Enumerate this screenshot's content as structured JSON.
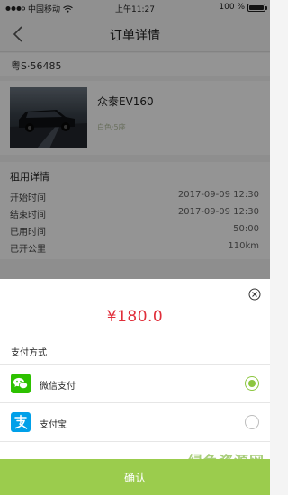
{
  "status_bar": {
    "carrier": "中国移动",
    "time": "上午11:27",
    "battery_text": "100 %",
    "battery_level": 1.0
  },
  "nav": {
    "title": "订单详情",
    "back_icon": "chevron-left-icon"
  },
  "order": {
    "plate": "粤S·56485",
    "car_name": "众泰EV160",
    "car_sub": "白色·5座"
  },
  "rental": {
    "title": "租用详情",
    "rows": [
      {
        "label": "开始时间",
        "value": "2017-09-09  12:30"
      },
      {
        "label": "结束时间",
        "value": "2017-09-09  12:30"
      },
      {
        "label": "已用时间",
        "value": "50:00"
      },
      {
        "label": "已开公里",
        "value": "110km"
      }
    ]
  },
  "payment": {
    "amount": "¥180.0",
    "method_label": "支付方式",
    "options": [
      {
        "label": "微信支付",
        "icon": "wechat-pay-icon",
        "selected": true
      },
      {
        "label": "支付宝",
        "icon": "alipay-icon",
        "selected": false
      }
    ],
    "confirm_label": "确认"
  },
  "watermark": {
    "text": "绿色资源网",
    "url": "www.downcc.com"
  },
  "colors": {
    "accent_green": "#9bcc4d",
    "amount_red": "#e02e3a",
    "radio_green": "#8cc63f",
    "wechat_green": "#2dc100",
    "alipay_blue": "#00a0e9"
  }
}
